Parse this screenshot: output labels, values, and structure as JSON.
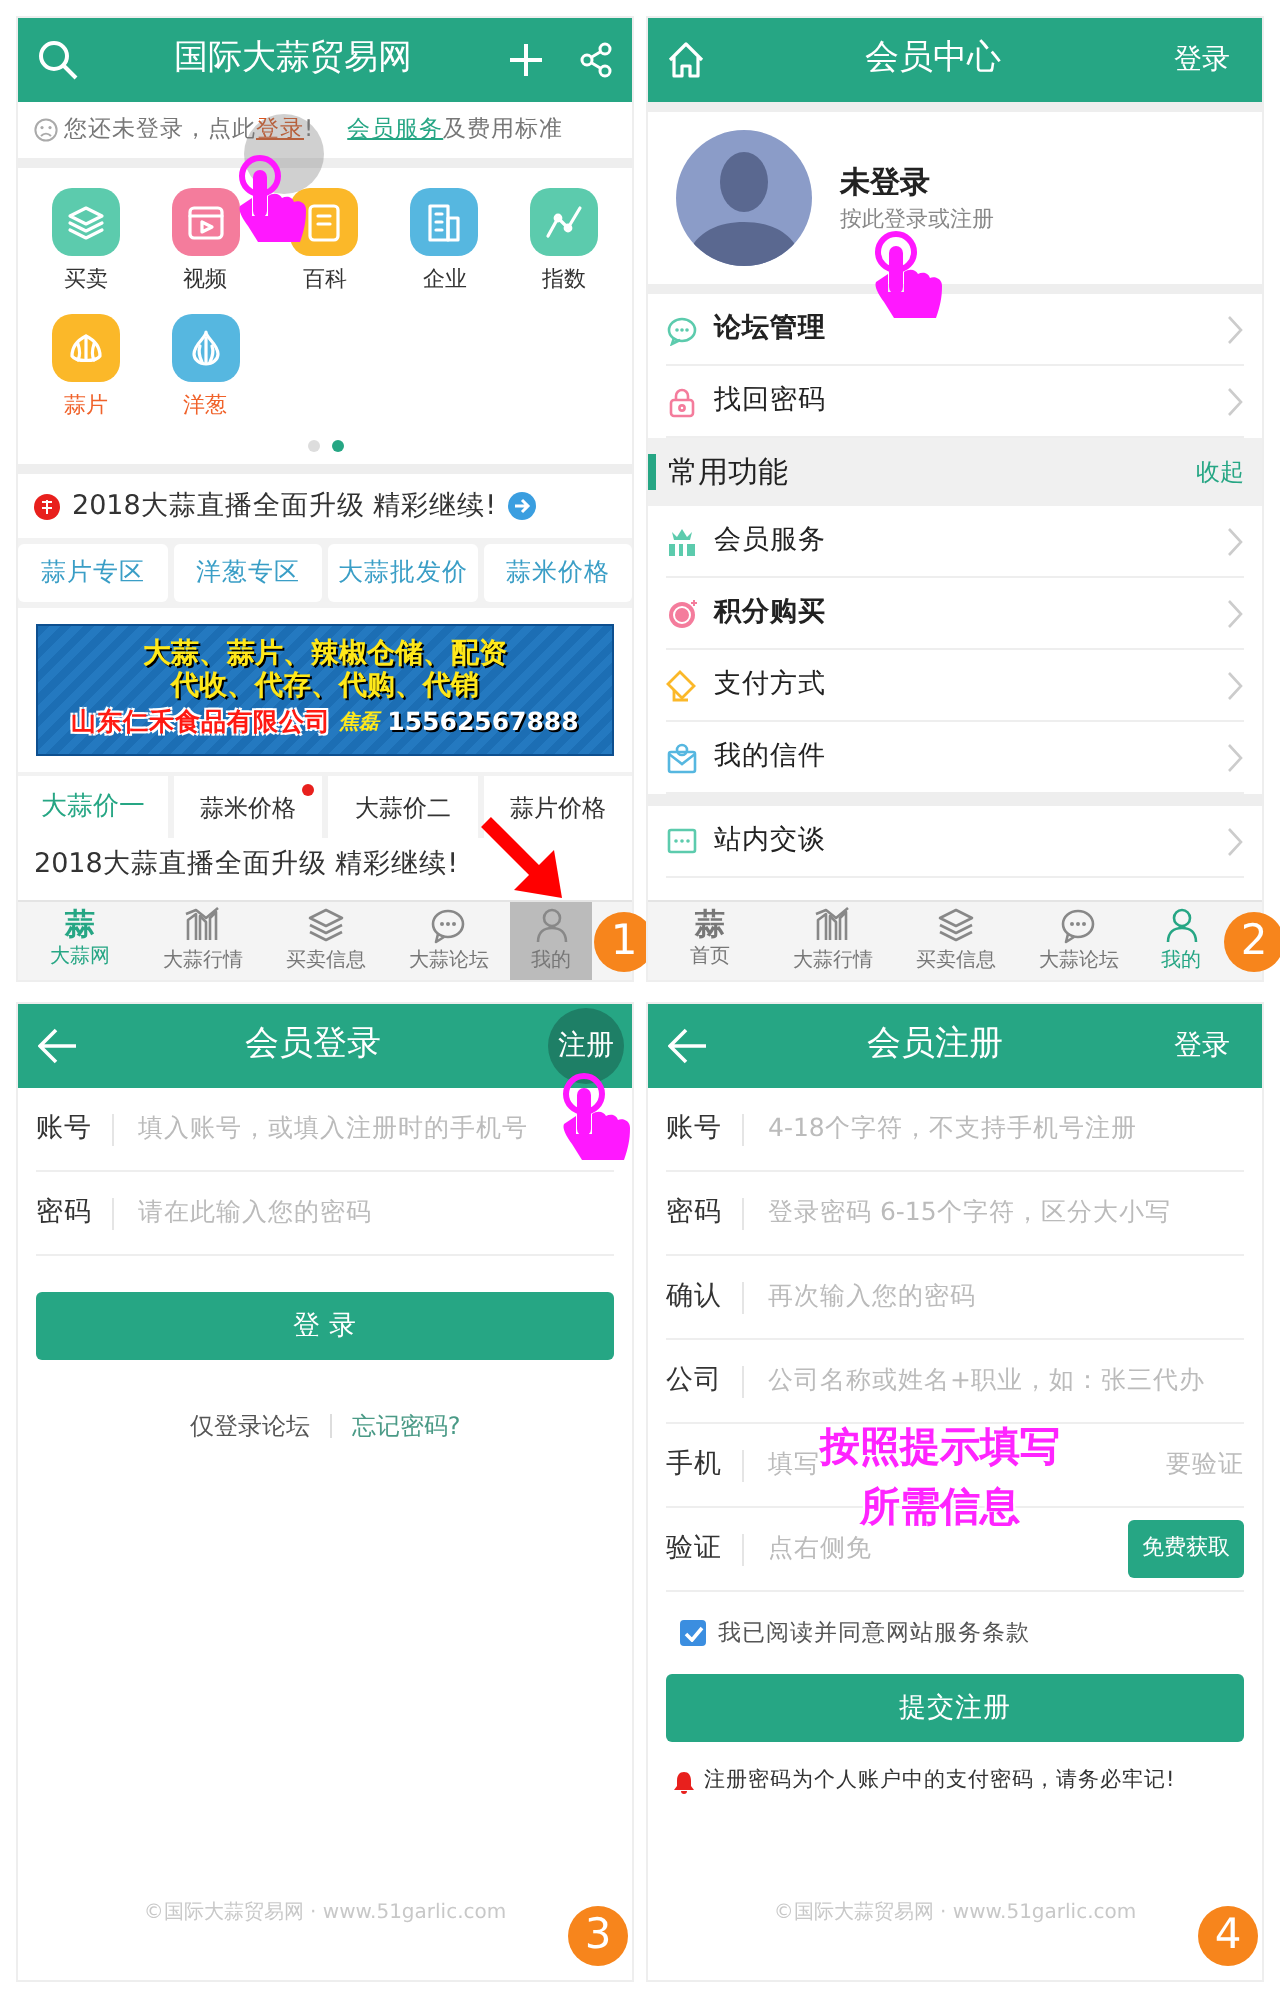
{
  "home": {
    "title": "国际大蒜贸易网",
    "notice": {
      "before": "您还未登录，点此",
      "login_link": "登录",
      "after": "!",
      "service_link": "会员服务",
      "service_after": "及费用标准"
    },
    "categories": [
      {
        "label": "买卖",
        "kind": "layers",
        "color": "#5ccbad",
        "highlight": false
      },
      {
        "label": "视频",
        "kind": "video",
        "color": "#f47c9c",
        "highlight": false
      },
      {
        "label": "百科",
        "kind": "book",
        "color": "#fbb829",
        "highlight": false
      },
      {
        "label": "企业",
        "kind": "building",
        "color": "#56b7e0",
        "highlight": false
      },
      {
        "label": "指数",
        "kind": "chart",
        "color": "#5ccbad",
        "highlight": false
      },
      {
        "label": "蒜片",
        "kind": "garlic",
        "color": "#fbb829",
        "highlight": true
      },
      {
        "label": "洋葱",
        "kind": "onion",
        "color": "#56b7e0",
        "highlight": true
      }
    ],
    "pager": [
      {
        "selected": false
      },
      {
        "selected": true
      }
    ],
    "headline": "2018大蒜直播全面升级 精彩继续!",
    "quick_links": [
      "蒜片专区",
      "洋葱专区",
      "大蒜批发价",
      "蒜米价格"
    ],
    "banner": {
      "lines": [
        "大蒜、蒜片、辣椒仓储、配资",
        "代收、代存、代购、代销"
      ],
      "company": "山东仁禾食品有限公司",
      "contact": "焦磊",
      "phone": "15562567888"
    },
    "price_tabs": [
      {
        "label": "大蒜价一",
        "selected": true,
        "dot": false
      },
      {
        "label": "蒜米价格",
        "selected": false,
        "dot": true
      },
      {
        "label": "大蒜价二",
        "selected": false,
        "dot": false
      },
      {
        "label": "蒜片价格",
        "selected": false,
        "dot": false
      }
    ],
    "news": "2018大蒜直播全面升级 精彩继续!",
    "tabbar": [
      {
        "label": "大蒜网",
        "kind": "glyph",
        "glyph": "蒜",
        "selected": true,
        "pressed": false
      },
      {
        "label": "大蒜行情",
        "kind": "market",
        "selected": false,
        "pressed": false
      },
      {
        "label": "买卖信息",
        "kind": "layers",
        "selected": false,
        "pressed": false
      },
      {
        "label": "大蒜论坛",
        "kind": "chat",
        "selected": false,
        "pressed": false
      },
      {
        "label": "我的",
        "kind": "person",
        "selected": false,
        "pressed": true
      }
    ]
  },
  "member": {
    "title": "会员中心",
    "right_action": "登录",
    "name": "未登录",
    "hint": "按此登录或注册",
    "items": [
      {
        "kind": "chat",
        "label": "论坛管理",
        "bold": true
      },
      {
        "kind": "lock",
        "label": "找回密码",
        "bold": false
      },
      {
        "kind": "section",
        "label": "常用功能",
        "action": "收起"
      },
      {
        "kind": "vip",
        "label": "会员服务",
        "bold": false
      },
      {
        "kind": "coin",
        "label": "积分购买",
        "bold": true
      },
      {
        "kind": "card",
        "label": "支付方式",
        "bold": false
      },
      {
        "kind": "mail",
        "label": "我的信件",
        "bold": false
      },
      {
        "kind": "gap"
      },
      {
        "kind": "message",
        "label": "站内交谈",
        "bold": false
      }
    ],
    "tabbar": [
      {
        "label": "首页",
        "kind": "glyph",
        "glyph": "蒜",
        "selected": false,
        "pressed": false
      },
      {
        "label": "大蒜行情",
        "kind": "market",
        "selected": false,
        "pressed": false
      },
      {
        "label": "买卖信息",
        "kind": "layers",
        "selected": false,
        "pressed": false
      },
      {
        "label": "大蒜论坛",
        "kind": "chat",
        "selected": false,
        "pressed": false
      },
      {
        "label": "我的",
        "kind": "person",
        "selected": true,
        "pressed": false
      }
    ]
  },
  "login": {
    "title": "会员登录",
    "right_action": "注册",
    "right_pressed": true,
    "fields": [
      {
        "label": "账号",
        "placeholder": "填入账号，或填入注册时的手机号"
      },
      {
        "label": "密码",
        "placeholder": "请在此输入您的密码"
      }
    ],
    "submit": "登 录",
    "links": [
      "仅登录论坛",
      "忘记密码?"
    ],
    "footer": "©国际大蒜贸易网 · www.51garlic.com"
  },
  "register": {
    "title": "会员注册",
    "right_action": "登录",
    "fields": [
      {
        "label": "账号",
        "placeholder": "4-18个字符，不支持手机号注册"
      },
      {
        "label": "密码",
        "placeholder": "登录密码 6-15个字符，区分大小写"
      },
      {
        "label": "确认",
        "placeholder": "再次输入您的密码"
      },
      {
        "label": "公司",
        "placeholder": "公司名称或姓名+职业，如：张三代办"
      },
      {
        "label": "手机",
        "placeholder": "填写",
        "tail": "要验证"
      },
      {
        "label": "验证",
        "placeholder": "点右侧免",
        "button": "免费获取"
      }
    ],
    "agree": {
      "label": "我已阅读并同意网站服务条款",
      "checked": true
    },
    "submit": "提交注册",
    "warning": "注册密码为个人账户中的支付密码，请务必牢记!",
    "footer": "©国际大蒜贸易网 · www.51garlic.com"
  },
  "annotations": {
    "steps": [
      "1",
      "2",
      "3",
      "4"
    ],
    "caption": [
      "按照提示填写",
      "所需信息"
    ]
  }
}
